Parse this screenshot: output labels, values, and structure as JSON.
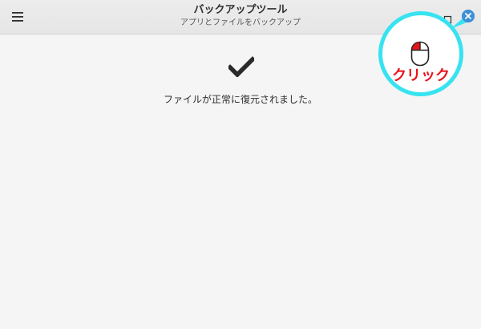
{
  "window": {
    "title": "バックアップツール",
    "subtitle": "アプリとファイルをバックアップ"
  },
  "content": {
    "status": "ファイルが正常に復元されました。"
  },
  "icons": {
    "menu": "hamburger-menu-icon",
    "maximize": "maximize-icon",
    "close": "close-icon",
    "success": "checkmark-icon",
    "mouse": "mouse-left-click-icon"
  },
  "annotation": {
    "label": "クリック"
  },
  "colors": {
    "close_button": "#3d8fd6",
    "callout_ring": "#37e3f0",
    "callout_text": "#e8141c",
    "background": "#f5f5f5",
    "headerbar": "#e8e8e8"
  }
}
